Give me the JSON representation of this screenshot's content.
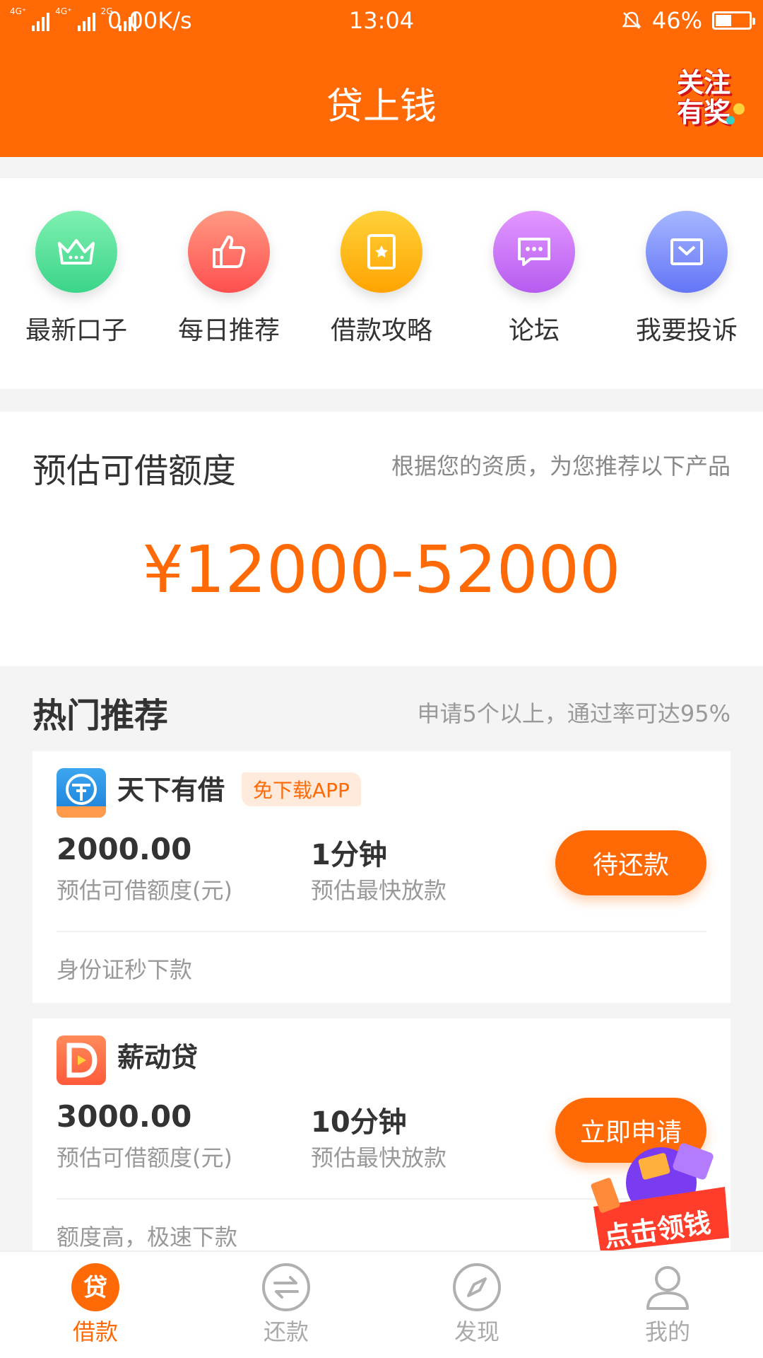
{
  "status_bar": {
    "network_left": "4G⁺",
    "network_mid": "4G⁺",
    "network_right": "2G",
    "speed": "0.00K/s",
    "time": "13:04",
    "battery": "46%"
  },
  "header": {
    "title": "贷上钱",
    "promo_text": "关注有奖"
  },
  "shortcuts": [
    {
      "label": "最新口子",
      "icon": "crown-icon",
      "color_top": "#7ff0b0",
      "color_bottom": "#3bd58a"
    },
    {
      "label": "每日推荐",
      "icon": "thumbs-up-icon",
      "color_top": "#ff9a82",
      "color_bottom": "#ff4f4f"
    },
    {
      "label": "借款攻略",
      "icon": "book-icon",
      "color_top": "#ffd23b",
      "color_bottom": "#ffa400"
    },
    {
      "label": "论坛",
      "icon": "chat-icon",
      "color_top": "#e398ff",
      "color_bottom": "#b65cf0"
    },
    {
      "label": "我要投诉",
      "icon": "mail-icon",
      "color_top": "#a6b7ff",
      "color_bottom": "#6475f7"
    }
  ],
  "quota": {
    "title": "预估可借额度",
    "subtitle": "根据您的资质，为您推荐以下产品",
    "amount": "¥12000-52000"
  },
  "hot": {
    "title": "热门推荐",
    "subtitle": "申请5个以上，通过率可达95%"
  },
  "products": [
    {
      "name": "天下有借",
      "tag": "免下载APP",
      "amount": "2000.00",
      "amount_label": "预估可借额度(元)",
      "speed": "1分钟",
      "speed_label": "预估最快放款",
      "button": "待还款",
      "note": "身份证秒下款",
      "logo_text": "天下有借"
    },
    {
      "name": "薪动贷",
      "tag": "",
      "amount": "3000.00",
      "amount_label": "预估可借额度(元)",
      "speed": "10分钟",
      "speed_label": "预估最快放款",
      "button": "立即申请",
      "note": "额度高，极速下款",
      "logo_text": "D"
    }
  ],
  "float_promo": {
    "text": "点击领钱"
  },
  "tabs": [
    {
      "label": "借款",
      "icon": "loan-icon",
      "active": true
    },
    {
      "label": "还款",
      "icon": "repay-icon",
      "active": false
    },
    {
      "label": "发现",
      "icon": "compass-icon",
      "active": false
    },
    {
      "label": "我的",
      "icon": "user-icon",
      "active": false
    }
  ],
  "colors": {
    "accent": "#ff6a07",
    "text_primary": "#333333",
    "text_secondary": "#999999"
  }
}
